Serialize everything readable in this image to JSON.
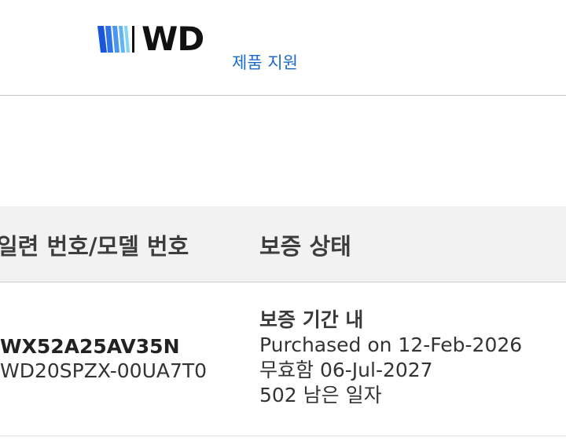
{
  "header": {
    "logo_text": "WD",
    "support_link": "제품 지원"
  },
  "table": {
    "columns": [
      "일련 번호/모델 번호",
      "보증 상태"
    ],
    "rows": [
      {
        "serial": "WX52A25AV35N",
        "model": "WD20SPZX-00UA7T0",
        "status_title": "보증 기간 내",
        "purchased": "Purchased on 12-Feb-2026",
        "expires": "무효함 06-Jul-2027",
        "days_left": "502 남은 일자"
      }
    ]
  },
  "colors": {
    "link": "#1b6ac9",
    "logo_bar_dark": "#1a56db",
    "logo_bar_light": "#7fd6f2"
  }
}
